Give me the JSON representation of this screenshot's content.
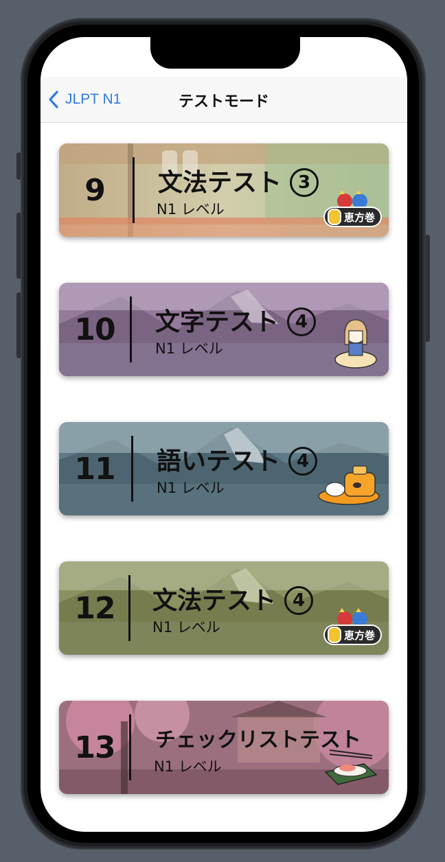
{
  "nav": {
    "back_label": "JLPT N1",
    "title": "テストモード"
  },
  "cards": [
    {
      "number": "9",
      "title": "文法テスト",
      "badge_number": "③",
      "level": "N1 レベル",
      "sticker": "恵方巻"
    },
    {
      "number": "10",
      "title": "文字テスト",
      "badge_number": "④",
      "level": "N1 レベル"
    },
    {
      "number": "11",
      "title": "語いテスト",
      "badge_number": "④",
      "level": "N1 レベル"
    },
    {
      "number": "12",
      "title": "文法テスト",
      "badge_number": "④",
      "level": "N1 レベル",
      "sticker": "恵方巻"
    },
    {
      "number": "13",
      "title": "チェックリストテスト",
      "level": "N1 レベル"
    }
  ],
  "colors": {
    "accent": "#2f7ae5",
    "background": "#57606a"
  }
}
